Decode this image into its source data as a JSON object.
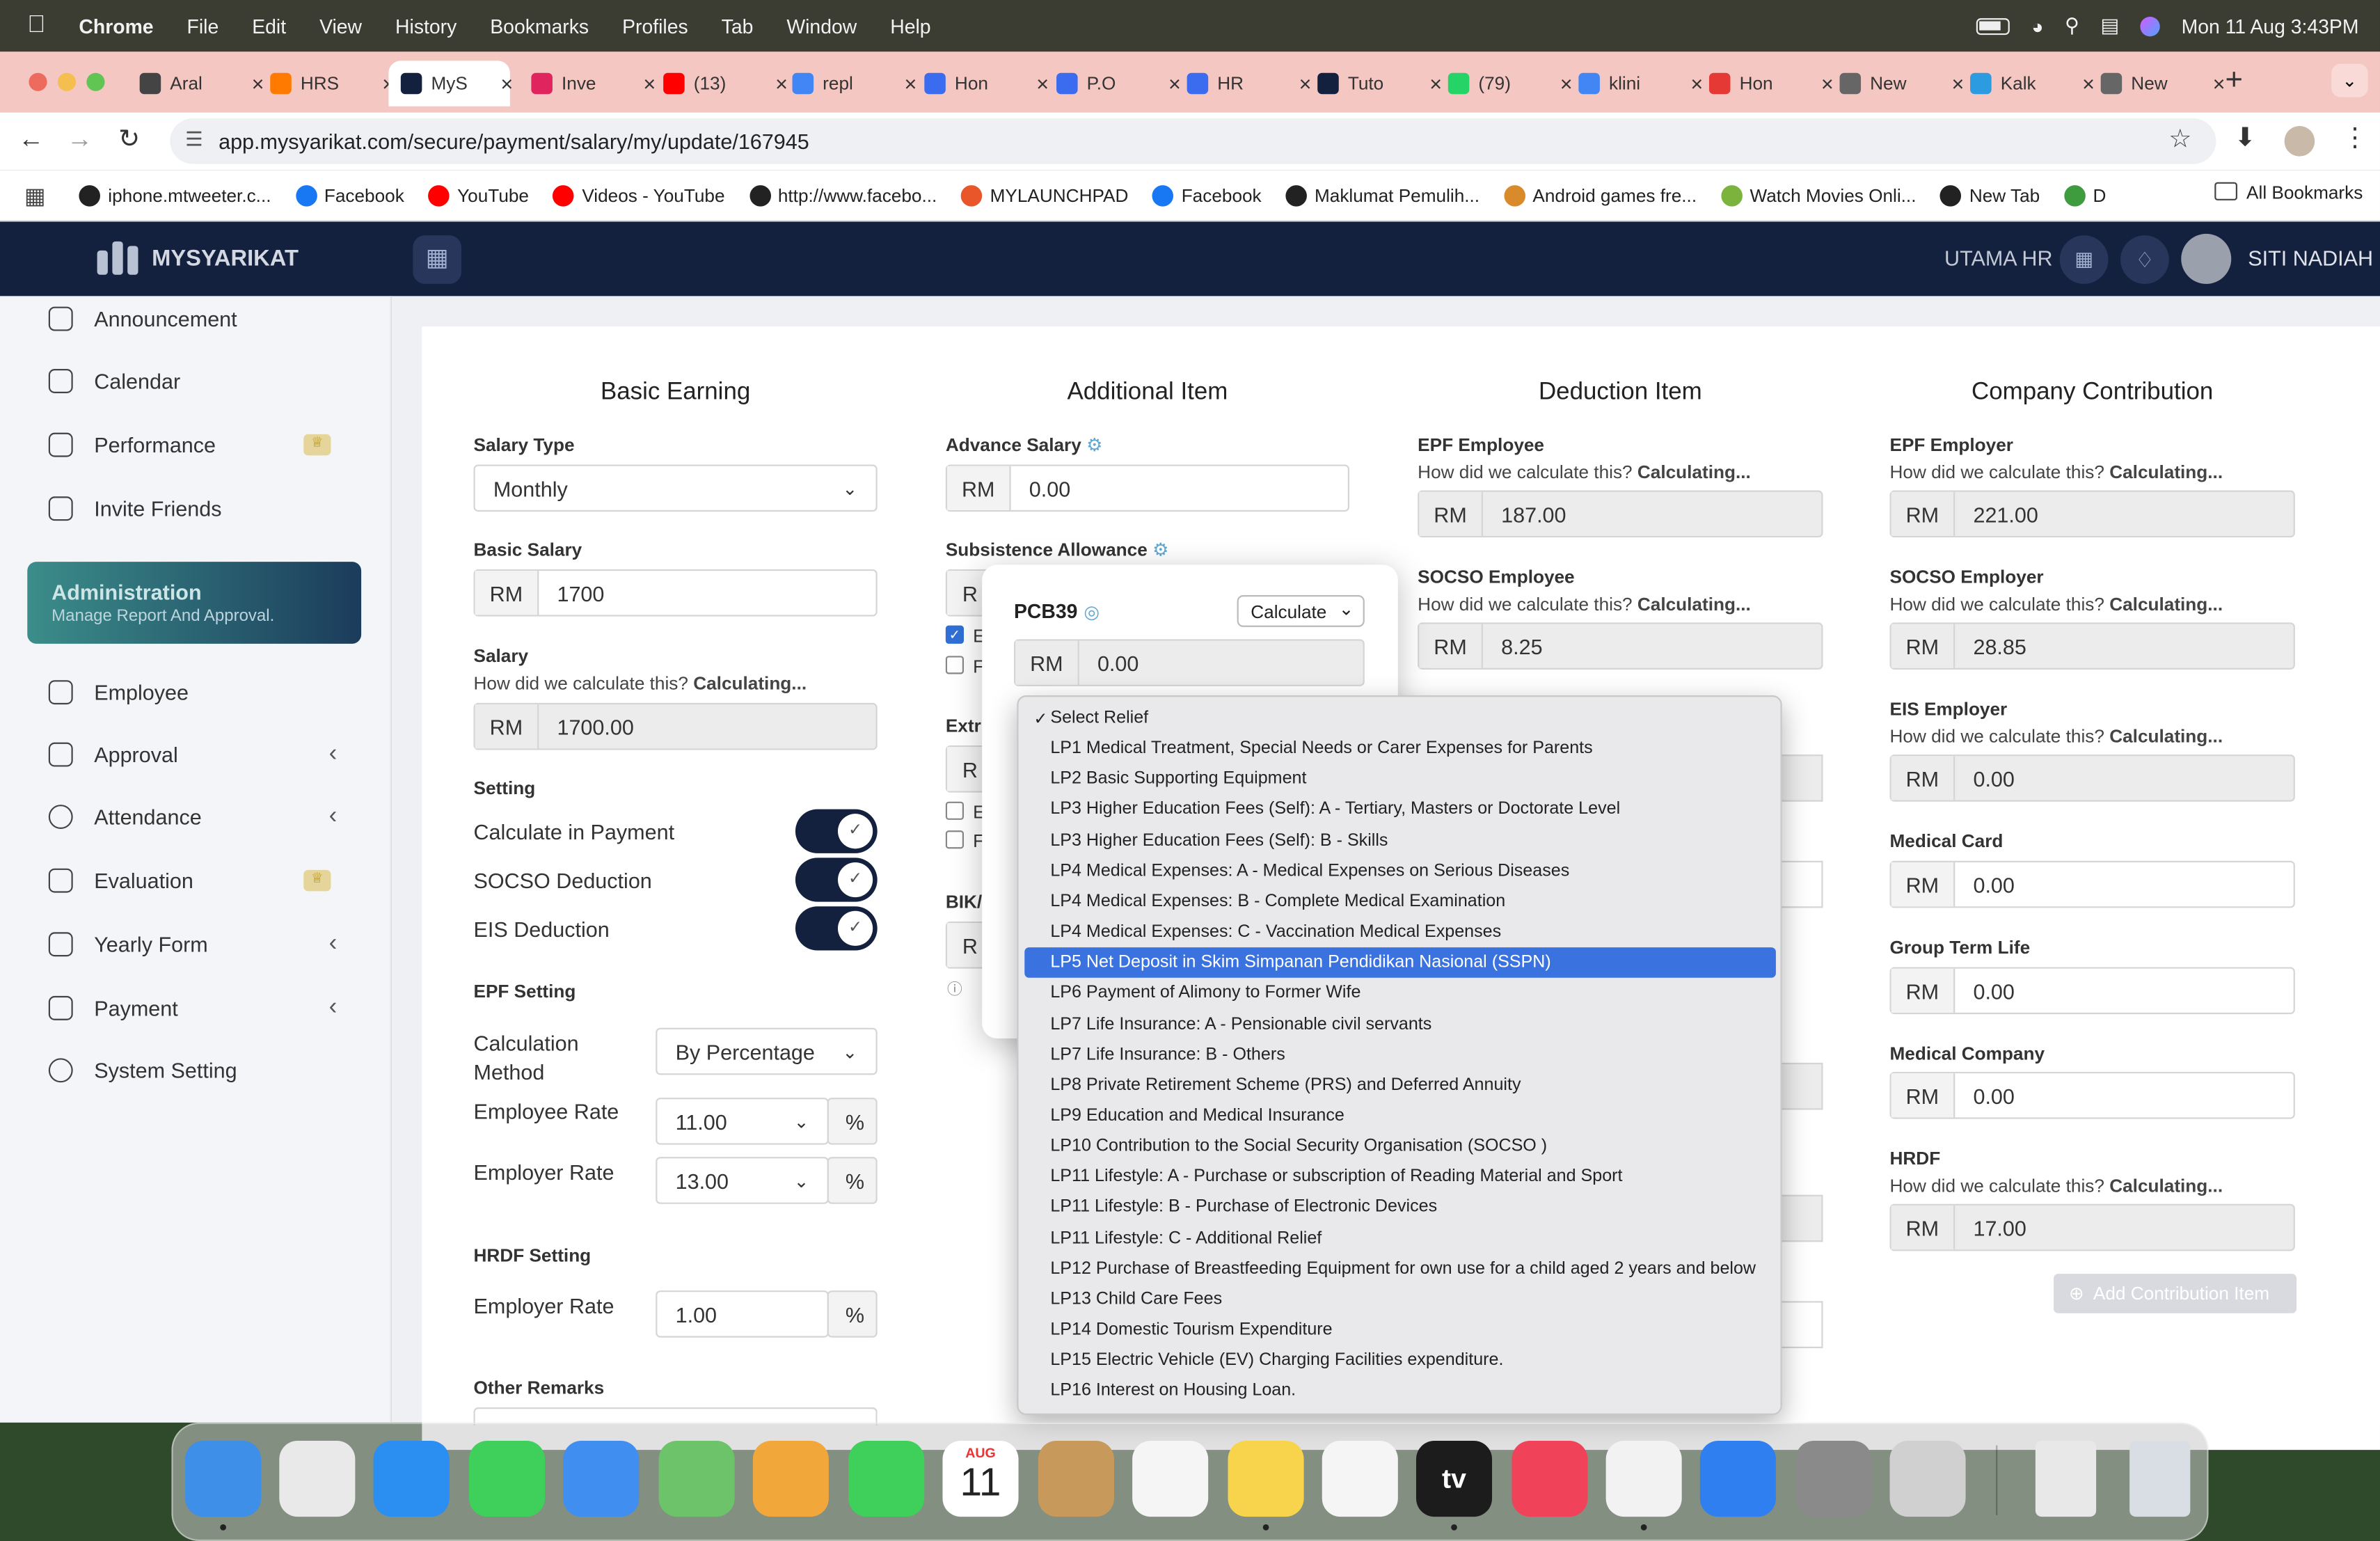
{
  "menubar": {
    "app": "Chrome",
    "items": [
      "File",
      "Edit",
      "View",
      "History",
      "Bookmarks",
      "Profiles",
      "Tab",
      "Window",
      "Help"
    ],
    "datetime": "Mon 11 Aug  3:43PM"
  },
  "tabs": [
    {
      "label": "Aral",
      "color": "#444"
    },
    {
      "label": "HRS",
      "color": "#ff7a00"
    },
    {
      "label": "MyS",
      "color": "#14213e"
    },
    {
      "label": "Inve",
      "color": "#e0245e"
    },
    {
      "label": "(13)",
      "color": "#ff0000"
    },
    {
      "label": "repl",
      "color": "#4285f4"
    },
    {
      "label": "Hon",
      "color": "#3b6cf0"
    },
    {
      "label": "P.O",
      "color": "#3b6cf0"
    },
    {
      "label": "HR",
      "color": "#3b6cf0"
    },
    {
      "label": "Tuto",
      "color": "#14213e"
    },
    {
      "label": "(79)",
      "color": "#25d366"
    },
    {
      "label": "klini",
      "color": "#4285f4"
    },
    {
      "label": "Hon",
      "color": "#e53935"
    },
    {
      "label": "New",
      "color": "#666"
    },
    {
      "label": "Kalk",
      "color": "#2c9be0"
    },
    {
      "label": "New",
      "color": "#666"
    }
  ],
  "address": {
    "url": "app.mysyarikat.com/secure/payment/salary/my/update/167945"
  },
  "bookmarks": [
    {
      "label": "iphone.mtweeter.c...",
      "color": "#222"
    },
    {
      "label": "Facebook",
      "color": "#1877f2"
    },
    {
      "label": "YouTube",
      "color": "#ff0000"
    },
    {
      "label": "Videos - YouTube",
      "color": "#ff0000"
    },
    {
      "label": "http://www.facebo...",
      "color": "#222"
    },
    {
      "label": "MYLAUNCHPAD",
      "color": "#e8562a"
    },
    {
      "label": "Facebook",
      "color": "#1877f2"
    },
    {
      "label": "Maklumat Pemulih...",
      "color": "#222"
    },
    {
      "label": "Android games fre...",
      "color": "#d98b2b"
    },
    {
      "label": "Watch Movies Onli...",
      "color": "#7bb33d"
    },
    {
      "label": "New Tab",
      "color": "#222"
    },
    {
      "label": "D",
      "color": "#3e9b3e"
    }
  ],
  "all_bookmarks": "All Bookmarks",
  "app": {
    "brand": "MYSYARIKAT",
    "company": "UTAMA HR",
    "user": "SITI NADIAH"
  },
  "sidebar": {
    "top_items": [
      "Announcement",
      "Calendar",
      "Performance",
      "Invite Friends"
    ],
    "admin_title": "Administration",
    "admin_sub": "Manage Report And Approval.",
    "admin_items": [
      "Employee",
      "Approval",
      "Attendance",
      "Evaluation",
      "Yearly Form",
      "Payment",
      "System Setting"
    ]
  },
  "basic": {
    "title": "Basic Earning",
    "salary_type_label": "Salary Type",
    "salary_type": "Monthly",
    "basic_salary_label": "Basic Salary",
    "currency": "RM",
    "basic_salary": "1700",
    "salary_label": "Salary",
    "hint": "How did we calculate this?",
    "calculating": "Calculating...",
    "salary": "1700.00",
    "setting_label": "Setting",
    "settings": [
      "Calculate in Payment",
      "SOCSO Deduction",
      "EIS Deduction"
    ],
    "epf_label": "EPF Setting",
    "calc_method_label": "Calculation Method",
    "calc_method": "By Percentage",
    "employee_rate_label": "Employee Rate",
    "employee_rate": "11.00",
    "employer_rate_label": "Employer Rate",
    "employer_rate": "13.00",
    "percent": "%",
    "hrdf_label": "HRDF Setting",
    "hrdf_rate_label": "Employer Rate",
    "hrdf_rate": "1.00",
    "other_remarks": "Other Remarks"
  },
  "additional": {
    "title": "Additional Item",
    "advance_label": "Advance Salary",
    "advance": "0.00",
    "subsistence_label": "Subsistence Allowance",
    "partial_rm": "R",
    "partial_e": "E",
    "partial_f": "F",
    "extra_label": "Extr",
    "bik_label": "BIK/"
  },
  "deduction": {
    "title": "Deduction Item",
    "epf_employee_label": "EPF Employee",
    "epf_employee": "187.00",
    "socso_employee_label": "SOCSO Employee",
    "socso_employee": "8.25"
  },
  "contribution": {
    "title": "Company Contribution",
    "epf_employer_label": "EPF Employer",
    "epf_employer": "221.00",
    "socso_employer_label": "SOCSO Employer",
    "socso_employer": "28.85",
    "eis_employer_label": "EIS Employer",
    "eis_employer": "0.00",
    "medical_card_label": "Medical Card",
    "medical_card": "0.00",
    "group_term_label": "Group Term Life",
    "group_term": "0.00",
    "medical_company_label": "Medical Company",
    "medical_company": "0.00",
    "hrdf_label": "HRDF",
    "hrdf": "17.00",
    "add_button": "Add Contribution Item"
  },
  "modal": {
    "title": "PCB39",
    "action": "Calculate",
    "currency": "RM",
    "value": "0.00"
  },
  "dropdown": {
    "selected_index": 0,
    "highlighted_index": 8,
    "options": [
      "Select Relief",
      "LP1 Medical Treatment, Special Needs or Carer Expenses for Parents",
      "LP2 Basic Supporting Equipment",
      "LP3 Higher Education Fees (Self): A - Tertiary, Masters or Doctorate Level",
      "LP3 Higher Education Fees (Self): B - Skills",
      "LP4 Medical Expenses: A - Medical Expenses on Serious Diseases",
      "LP4 Medical Expenses: B - Complete Medical Examination",
      "LP4 Medical Expenses: C - Vaccination Medical Expenses",
      "LP5 Net Deposit in Skim Simpanan Pendidikan Nasional (SSPN)",
      "LP6 Payment of Alimony to Former Wife",
      "LP7 Life Insurance: A - Pensionable civil servants",
      "LP7 Life Insurance: B - Others",
      "LP8 Private Retirement Scheme (PRS) and Deferred Annuity",
      "LP9 Education and Medical Insurance",
      "LP10 Contribution to the Social Security Organisation (SOCSO )",
      "LP11 Lifestyle: A - Purchase or subscription of Reading Material and Sport",
      "LP11 Lifestyle: B - Purchase of Electronic Devices",
      "LP11 Lifestyle: C - Additional Relief",
      "LP12 Purchase of Breastfeeding Equipment for own use for a child aged 2 years and below",
      "LP13 Child Care Fees",
      "LP14 Domestic Tourism Expenditure",
      "LP15 Electric Vehicle (EV) Charging Facilities expenditure.",
      "LP16 Interest on Housing Loan."
    ]
  },
  "calendar_icon": {
    "month": "AUG",
    "day": "11"
  },
  "dock": [
    {
      "name": "finder-icon",
      "color": "#3d8fe8"
    },
    {
      "name": "launchpad-icon",
      "color": "#e9e9e9"
    },
    {
      "name": "safari-icon",
      "color": "#2a8ff0"
    },
    {
      "name": "messages-icon",
      "color": "#3fcf5b"
    },
    {
      "name": "mail-icon",
      "color": "#3f8ef0"
    },
    {
      "name": "maps-icon",
      "color": "#6cc36a"
    },
    {
      "name": "photos-icon",
      "color": "#f2a73b"
    },
    {
      "name": "facetime-icon",
      "color": "#3fcf5b"
    },
    {
      "name": "calendar-icon",
      "color": "#ffffff"
    },
    {
      "name": "contacts-icon",
      "color": "#c79a5c"
    },
    {
      "name": "reminders-icon",
      "color": "#f5f5f5"
    },
    {
      "name": "notes-icon",
      "color": "#f7d44c"
    },
    {
      "name": "freeform-icon",
      "color": "#f5f5f5"
    },
    {
      "name": "tv-icon",
      "color": "#1c1c1c"
    },
    {
      "name": "music-icon",
      "color": "#f0435a"
    },
    {
      "name": "chrome-icon",
      "color": "#f2f2f2"
    },
    {
      "name": "app-store-icon",
      "color": "#2f7ff0"
    },
    {
      "name": "settings-icon",
      "color": "#8a8a8a"
    },
    {
      "name": "iphone-mirroring-icon",
      "color": "#d0d0d0"
    },
    {
      "name": "downloads-stack-icon",
      "color": "#e8e8e8"
    },
    {
      "name": "trash-icon",
      "color": "#d8dee3"
    }
  ],
  "dock_tv_label": "tv"
}
